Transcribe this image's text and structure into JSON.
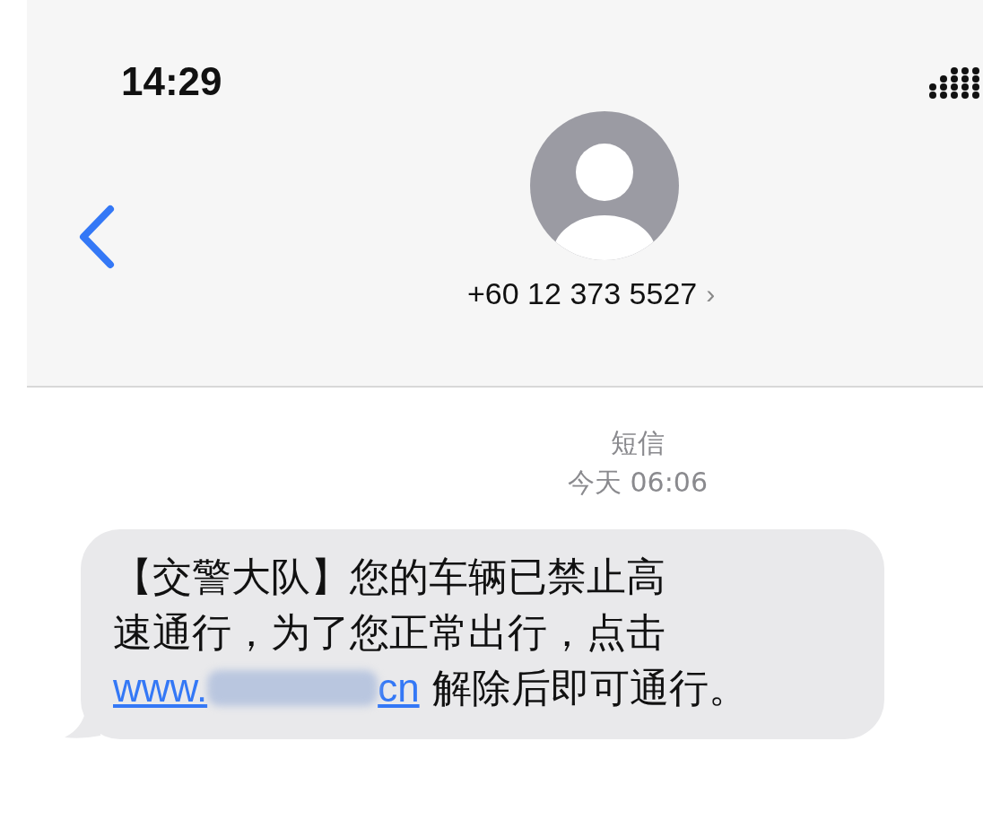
{
  "status_bar": {
    "time": "14:29"
  },
  "header": {
    "contact": "+60 12 373 5527",
    "chevron": "›"
  },
  "thread": {
    "service": "短信",
    "timestamp": "今天 06:06"
  },
  "message": {
    "lines": [
      "【交警大队】您的车辆已禁止高",
      "速通行，为了您正常出行，点击"
    ],
    "link": {
      "start": "www.",
      "end": "cn"
    },
    "after_link": "解除后即可通行。"
  }
}
